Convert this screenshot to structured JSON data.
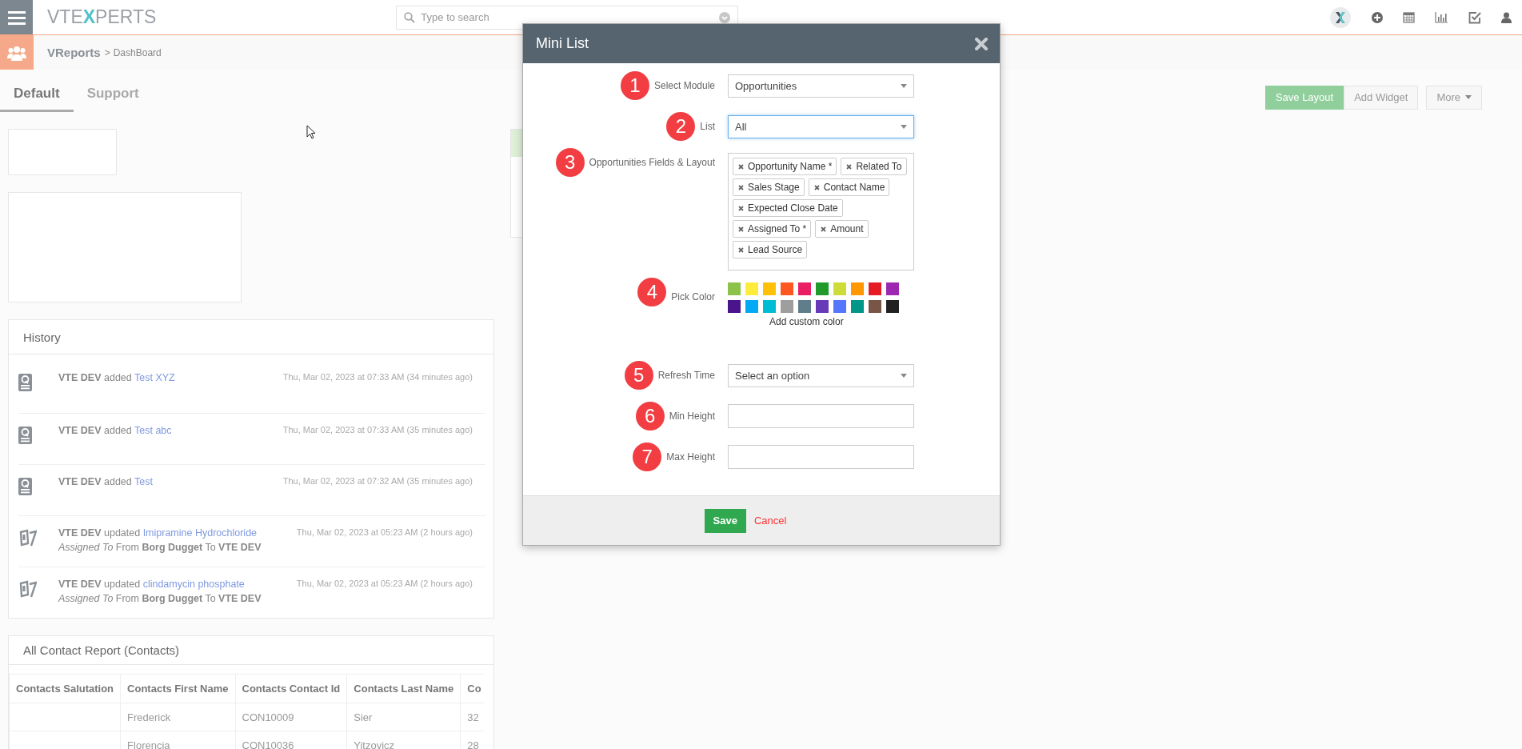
{
  "topbar": {
    "logo_parts": [
      "VTE",
      "X",
      "PERTS"
    ],
    "search": {
      "placeholder": "Type to search"
    }
  },
  "breadcrumb": {
    "module": "VReports",
    "separator": ">",
    "page": "DashBoard"
  },
  "tabs": [
    {
      "label": "Default",
      "selected": true
    },
    {
      "label": "Support",
      "selected": false
    }
  ],
  "toolbar": [
    {
      "label": "Save Layout",
      "kind": "primary"
    },
    {
      "label": "Add Widget",
      "kind": "plain"
    },
    {
      "label": "More",
      "kind": "dropdown"
    }
  ],
  "history": {
    "title": "History",
    "entries": [
      {
        "kind": "record",
        "actor": "VTE DEV",
        "action": "added",
        "link": "Test XYZ",
        "time": "Thu, Mar 02, 2023 at 07:33 AM (34 minutes ago)"
      },
      {
        "kind": "record",
        "actor": "VTE DEV",
        "action": "added",
        "link": "Test abc",
        "time": "Thu, Mar 02, 2023 at 07:33 AM (35 minutes ago)"
      },
      {
        "kind": "record",
        "actor": "VTE DEV",
        "action": "added",
        "link": "Test",
        "time": "Thu, Mar 02, 2023 at 07:32 AM (35 minutes ago)"
      },
      {
        "kind": "update",
        "actor": "VTE DEV",
        "action": "updated",
        "link": "Imipramine Hydrochloride",
        "time": "Thu, Mar 02, 2023 at 05:23 AM (2 hours ago)",
        "detail": "*Assigned To* From **Borg Dugget** To **VTE DEV**"
      },
      {
        "kind": "update",
        "actor": "VTE DEV",
        "action": "updated",
        "link": "clindamycin phosphate",
        "time": "Thu, Mar 02, 2023 at 05:23 AM (2 hours ago)",
        "detail": "*Assigned To* From **Borg Dugget** To **VTE DEV**"
      }
    ]
  },
  "contact_report": {
    "title": "All Contact Report (Contacts)",
    "table": {
      "columns": [
        "Contacts Salutation",
        "Contacts First Name",
        "Contacts Contact Id",
        "Contacts Last Name",
        "Co"
      ],
      "rows": [
        [
          null,
          "Frederick",
          "CON10009",
          "Sier",
          "32"
        ],
        [
          null,
          "Florencia",
          "CON10036",
          "Yitzovicz",
          "28"
        ]
      ]
    }
  },
  "modal": {
    "title": "Mini List",
    "rows": [
      {
        "step": "1",
        "label": "Select Module",
        "kind": "select",
        "value": "Opportunities",
        "focused": false
      },
      {
        "step": "2",
        "label": "List",
        "kind": "select",
        "value": "All",
        "focused": true
      },
      {
        "step": "3",
        "label": "Opportunities Fields & Layout",
        "kind": "tags",
        "tags": [
          "Opportunity Name *",
          "Related To",
          "Sales Stage",
          "Contact Name",
          "Expected Close Date",
          "Assigned To *",
          "Amount",
          "Lead Source"
        ]
      },
      {
        "step": "4",
        "label": "Pick Color",
        "kind": "colors",
        "custom_label": "Add custom color",
        "colors": [
          {
            "color": "#8bc34a"
          },
          {
            "color": "#ffeb3b"
          },
          {
            "color": "#ffc107"
          },
          {
            "color": "#ff5722"
          },
          {
            "color": "#e91e63"
          },
          {
            "color": "#1f9a2b"
          },
          {
            "color": "#cddc39"
          },
          {
            "color": "#ff9800"
          },
          {
            "color": "#e51c23"
          },
          {
            "color": "#9c27b0"
          },
          {
            "color": "#4a148c"
          },
          {
            "color": "#03a9f4"
          },
          {
            "color": "#00bcd4"
          },
          {
            "color": "#9e9e9e"
          },
          {
            "color": "#607d8b"
          },
          {
            "color": "#673ab7"
          },
          {
            "color": "#5677fc"
          },
          {
            "color": "#009688"
          },
          {
            "color": "#795548"
          },
          {
            "color": "#212121"
          }
        ]
      },
      {
        "step": "5",
        "label": "Refresh Time",
        "kind": "select",
        "placeholder": "Select an option",
        "focused": false
      },
      {
        "step": "6",
        "label": "Min Height",
        "kind": "input",
        "focused": false
      },
      {
        "step": "7",
        "label": "Max Height",
        "kind": "input",
        "focused": false
      }
    ],
    "save": "Save",
    "cancel": "Cancel"
  }
}
